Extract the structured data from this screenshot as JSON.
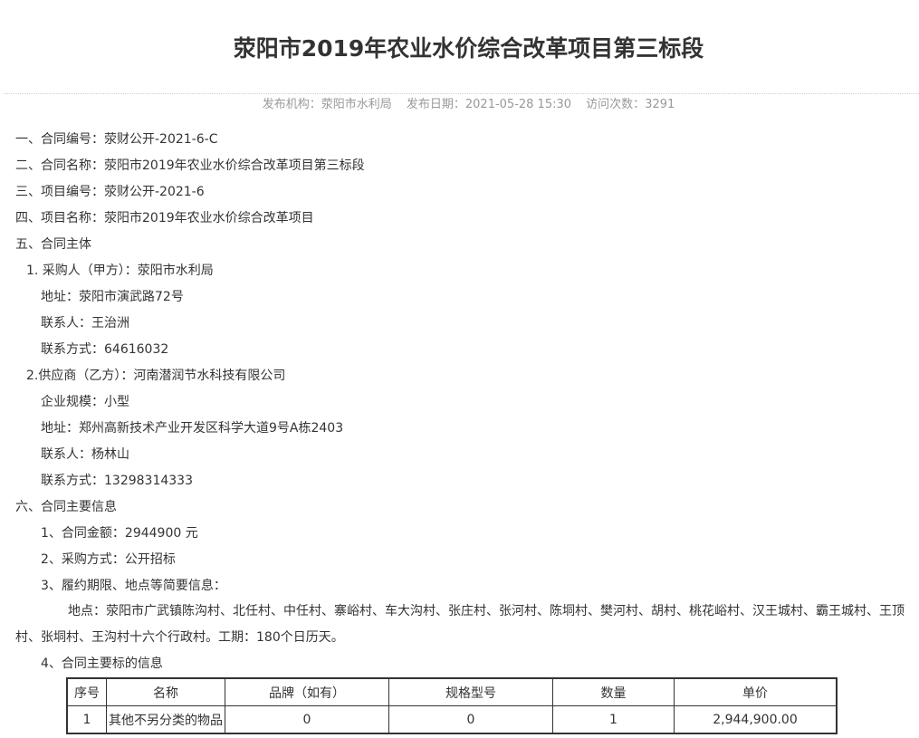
{
  "title": "荥阳市2019年农业水价综合改革项目第三标段",
  "meta": {
    "publisher": "发布机构：荥阳市水利局",
    "date": "发布日期：2021-05-28 15:30",
    "visits": "访问次数：3291"
  },
  "lines": {
    "l1": "一、合同编号：荥财公开-2021-6-C",
    "l2": "二、合同名称：荥阳市2019年农业水价综合改革项目第三标段",
    "l3": "三、项目编号：荥财公开-2021-6",
    "l4": "四、项目名称：荥阳市2019年农业水价综合改革项目",
    "l5": "五、合同主体",
    "l6": "1. 采购人（甲方）：荥阳市水利局",
    "l7": "地址：荥阳市演武路72号",
    "l8": "联系人：王治洲",
    "l9": "联系方式：64616032",
    "l10": "2.供应商（乙方）：河南潜润节水科技有限公司",
    "l11": "企业规模：小型",
    "l12": "地址：郑州高新技术产业开发区科学大道9号A栋2403",
    "l13": "联系人：杨林山",
    "l14": "联系方式：13298314333",
    "l15": "六、合同主要信息",
    "l16": "1、合同金额：2944900 元",
    "l17": "2、采购方式：公开招标",
    "l18": "3、履约期限、地点等简要信息：",
    "l19": "地点：荥阳市广武镇陈沟村、北任村、中任村、寨峪村、车大沟村、张庄村、张河村、陈垌村、樊河村、胡村、桃花峪村、汉王城村、霸王城村、王顶村、张垌村、王沟村十六个行政村。工期：180个日历天。",
    "l20": "4、合同主要标的信息"
  },
  "table": {
    "headers": [
      "序号",
      "名称",
      "品牌（如有）",
      "规格型号",
      "数量",
      "单价"
    ],
    "rows": [
      [
        "1",
        "其他不另分类的物品",
        "0",
        "0",
        "1",
        "2,944,900.00"
      ]
    ]
  }
}
